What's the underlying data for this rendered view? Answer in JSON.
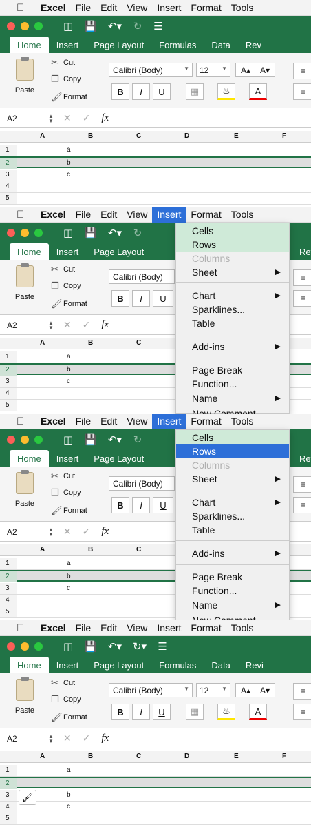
{
  "menubar": {
    "apple_icon": "apple-icon",
    "app_name": "Excel",
    "items": [
      "File",
      "Edit",
      "View",
      "Insert",
      "Format",
      "Tools"
    ]
  },
  "ribbon_tabs": [
    "Home",
    "Insert",
    "Page Layout",
    "Formulas",
    "Data",
    "Rev"
  ],
  "ribbon_tabs_last_frame": [
    "Home",
    "Insert",
    "Page Layout",
    "Formulas",
    "Data",
    "Revi"
  ],
  "clipboard": {
    "paste": "Paste",
    "cut": "Cut",
    "copy": "Copy",
    "format": "Format"
  },
  "font": {
    "name": "Calibri (Body)",
    "size": "12",
    "grow": "A▴",
    "shrink": "A▾",
    "bold": "B",
    "italic": "I",
    "underline": "U",
    "fill": "A",
    "color": "A"
  },
  "formula_bar": {
    "name_box": "A2",
    "cancel": "✕",
    "enter": "✓",
    "fx": "fx"
  },
  "columns": [
    "A",
    "B",
    "C",
    "D",
    "E",
    "F"
  ],
  "rows": {
    "numbers": [
      "1",
      "2",
      "3",
      "4",
      "5"
    ],
    "frame1": [
      "a",
      "b",
      "c",
      "",
      ""
    ],
    "frame4": [
      "a",
      "",
      "b",
      "c",
      ""
    ]
  },
  "insert_menu": {
    "cells": "Cells",
    "rows": "Rows",
    "columns": "Columns",
    "sheet": "Sheet",
    "chart": "Chart",
    "sparklines": "Sparklines...",
    "table": "Table",
    "addins": "Add-ins",
    "page_break": "Page Break",
    "function": "Function...",
    "name": "Name",
    "new_comment": "New Comment"
  },
  "colors": {
    "excel_green": "#217346",
    "highlight": "#2d6fd8"
  }
}
